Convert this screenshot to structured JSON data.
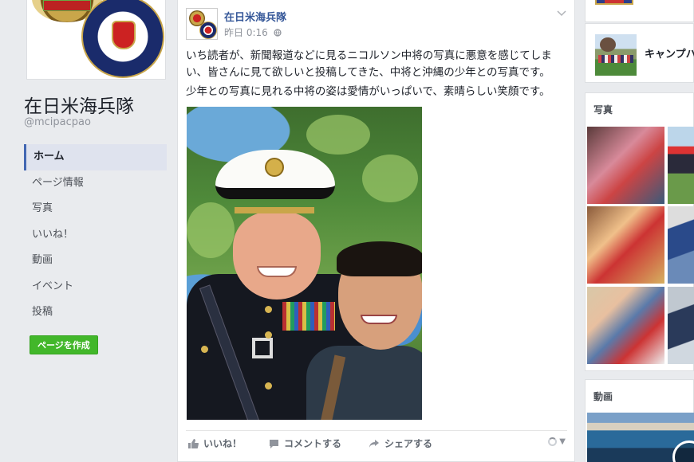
{
  "page": {
    "name": "在日米海兵隊",
    "handle": "@mcipacpao"
  },
  "nav": {
    "items": [
      {
        "label": "ホーム",
        "active": true
      },
      {
        "label": "ページ情報",
        "active": false
      },
      {
        "label": "写真",
        "active": false
      },
      {
        "label": "いいね！",
        "active": false
      },
      {
        "label": "動画",
        "active": false
      },
      {
        "label": "イベント",
        "active": false
      },
      {
        "label": "投稿",
        "active": false
      }
    ],
    "create_page_label": "ページを作成"
  },
  "post": {
    "author": "在日米海兵隊",
    "time": "昨日 0:16",
    "privacy_icon": "globe-icon",
    "paragraphs": [
      "いち読者が、新聞報道などに見るニコルソン中将の写真に悪意を感じてしまい、皆さんに見て欲しいと投稿してきた、中将と沖縄の少年との写真です。",
      "少年との写真に見れる中将の姿は愛情がいっぱいで、素晴らしい笑顔です。"
    ],
    "actions": {
      "like": "いいね！",
      "comment": "コメントする",
      "share": "シェアする"
    }
  },
  "sidebar": {
    "camp_label": "キャンプハ",
    "photos_title": "写真",
    "videos_title": "動画"
  },
  "colors": {
    "link": "#365899",
    "accent": "#4267b2",
    "create_button": "#42b72a",
    "background": "#e9ebee"
  }
}
